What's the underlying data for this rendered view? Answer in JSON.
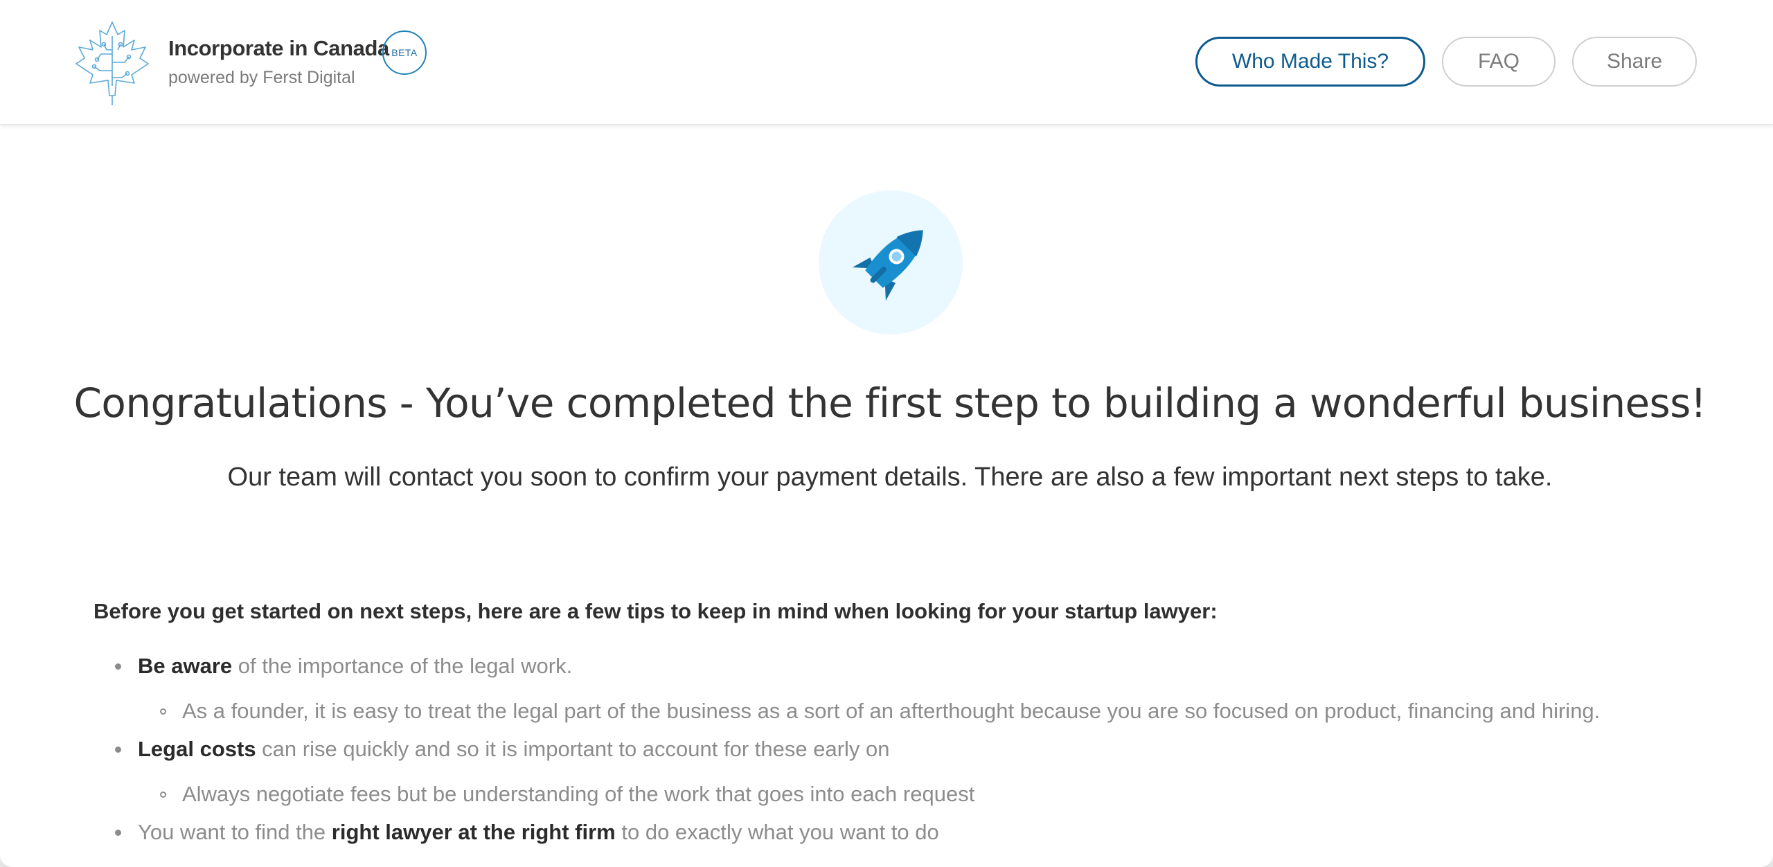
{
  "brand": {
    "title": "Incorporate in Canada",
    "subtitle": "powered by Ferst Digital",
    "badge": "BETA",
    "logo_icon": "maple-leaf-circuit-icon"
  },
  "nav": {
    "who_made": "Who Made This?",
    "faq": "FAQ",
    "share": "Share"
  },
  "hero": {
    "icon": "rocket-icon",
    "headline": "Congratulations - You’ve completed the first step to building a wonderful business!",
    "subline": "Our team will contact you soon to confirm your payment details. There are also a few important next steps to take."
  },
  "tips": {
    "intro": "Before you get started on next steps, here are a few tips to keep in mind when looking for your startup lawyer:",
    "item1": {
      "bold": "Be aware",
      "rest": " of the importance of the legal work."
    },
    "item1_sub": "As a founder, it is easy to treat the legal part of the business as a sort of an afterthought because you are so focused on product, financing and hiring.",
    "item2": {
      "bold": "Legal costs",
      "rest": " can rise quickly and so it is important to account for these early on"
    },
    "item2_sub": "Always negotiate fees but be understanding of the work that goes into each request",
    "item3": {
      "pre": "You want to find the ",
      "bold": "right lawyer at the right firm",
      "rest": " to do exactly what you want to do"
    }
  },
  "colors": {
    "accent": "#0d5b8e",
    "rocket_blue": "#1a8fd0",
    "rocket_bg": "#eaf8ff",
    "text_dark": "#333333",
    "text_muted": "#8c8c8c"
  }
}
